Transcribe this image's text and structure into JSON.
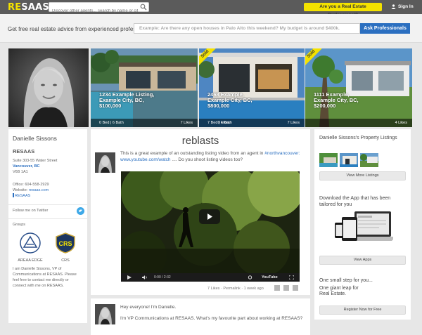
{
  "topbar": {
    "logo_re": "RE",
    "logo_saas": "SAAS",
    "logo_tm": "®",
    "search_placeholder": "Discover other agents... search by name or city",
    "pro_button": "Are you a Real Estate Professional?",
    "signin": "Sign In"
  },
  "ask": {
    "lead": "Get free real estate advice from experienced professionals.",
    "placeholder": "Example: Are there any open houses in Palo Alto this weekend? My budget is around $400k.",
    "button": "Ask Professionals"
  },
  "listings": [
    {
      "title": "1234 Example Listing,",
      "city": "Example City, BC,",
      "price": "$100,000",
      "beds": "0 Bed | 6 Bath",
      "likes": "7 Likes",
      "sold": ""
    },
    {
      "title": "2468 Example,",
      "city": "Example City, BC,",
      "price": "$800,000",
      "beds": "7 Bed | 4 Bath",
      "likes": "7 Likes",
      "sold": "Sold"
    },
    {
      "title": "1111 Example,",
      "city": "Example City, BC,",
      "price": "$200,000",
      "beds": "",
      "likes": "4 Likes",
      "sold": "Sold"
    }
  ],
  "extra_likes": "0 Likes",
  "profile": {
    "name": "Danielle Sissons",
    "company": "RESAAS",
    "addr_line1": "Suite 303-55 Water Street",
    "city": "Vancouver, BC",
    "postal": "V6B 1A1",
    "office": "Office: 604-558-2929",
    "website_label": "Website: ",
    "website": "resaas.com",
    "social": "RESAAS",
    "twitter": "Follow me on Twitter",
    "groups_label": "Groups",
    "groups": [
      {
        "label": "AREAA EDGE"
      },
      {
        "label": "CRS"
      }
    ],
    "bio": "I am Danielle Sissons, VP of Communications at RESAAS. Please feel free to contact me directly or connect with me on RESAAS."
  },
  "feed": {
    "title": "reblasts",
    "post1_text": "This is a great example of an outstanding listing video from an agent in",
    "post1_link": "#northvancouver: www.youtube.com/watch",
    "post1_tail": " .... Do you shoot listing videos too?",
    "video_time": "0:00 / 2:32",
    "video_brand": "YouTube",
    "likes": "7 Likes",
    "permalink": "Permalink",
    "ago": "1 week ago",
    "post2_line1": "Hey everyone! I'm Danielle.",
    "post2_line2": "I'm VP Communications at RESAAS. What's my favourite part about working at RESAAS?"
  },
  "sidebar": {
    "title": "Danielle Sissons's Property Listings",
    "view_more": "View More Listings",
    "download": "Download the App that has been tailored for you",
    "view_apps": "View Apps",
    "step": "One small step for you...",
    "leap": "One giant leap for Real Estate.",
    "register": "Register Now for Free"
  },
  "colors": {
    "accent": "#f4e200",
    "link": "#2b6fc0",
    "topbar": "#5b5b5b"
  }
}
